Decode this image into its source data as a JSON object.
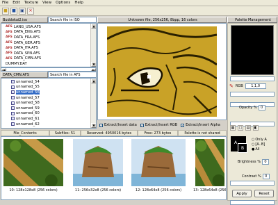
{
  "menu": [
    "File",
    "Edit",
    "Texture",
    "View",
    "Options",
    "Help"
  ],
  "left": {
    "tab_iso": "Buddokai2.iso",
    "search_iso": "Search file in ISO",
    "iso_files": [
      {
        "name": "LANG_USA.AFS",
        "tag": "AFS",
        "selected": false
      },
      {
        "name": "DATA_ENG.AFS",
        "tag": "AFS",
        "selected": false
      },
      {
        "name": "DATA_FRA.AFS",
        "tag": "AFS",
        "selected": false
      },
      {
        "name": "DATA_GER.AFS",
        "tag": "AFS",
        "selected": false
      },
      {
        "name": "DATA_ITA.AFS",
        "tag": "AFS",
        "selected": false
      },
      {
        "name": "DATA_SPN.AFS",
        "tag": "AFS",
        "selected": false
      },
      {
        "name": "DATA_CMN.AFS",
        "tag": "AFS",
        "selected": false
      },
      {
        "name": "DUMMY.DAT",
        "tag": "",
        "selected": false
      }
    ],
    "tab_afs": "DATA_CMN.AFS",
    "search_afs": "Search file in AFS",
    "afs_files": [
      {
        "name": "unnamed_54",
        "selected": false
      },
      {
        "name": "unnamed_55",
        "selected": false
      },
      {
        "name": "unnamed_56",
        "selected": true
      },
      {
        "name": "unnamed_57",
        "selected": false
      },
      {
        "name": "unnamed_58",
        "selected": false
      },
      {
        "name": "unnamed_59",
        "selected": false
      },
      {
        "name": "unnamed_60",
        "selected": false
      },
      {
        "name": "unnamed_61",
        "selected": false
      },
      {
        "name": "unnamed_62",
        "selected": false
      }
    ]
  },
  "viewer": {
    "title": "Unknown file, 256x256, 8bpp, 16 colors",
    "extract_data": "Extract/Insert data",
    "extract_rgb": "Extract/Insert RGB",
    "extract_alpha": "Extract/Insert Alpha"
  },
  "status": {
    "file_contents": "File_Contents",
    "subfiles": "Subfiles: 51",
    "reserved": "Reserved: 4950016 bytes",
    "free": "Free: 273 bytes",
    "palette": "Palette is not shared"
  },
  "thumbs": [
    {
      "caption": "10: 128x128x8 (256 colors)",
      "kind": "tree"
    },
    {
      "caption": "11: 256x32x8 (256 colors)",
      "kind": "island"
    },
    {
      "caption": "12: 128x64x8 (256 colors)",
      "kind": "island"
    },
    {
      "caption": "13: 128x64x8 (256 colors)",
      "kind": "tree"
    }
  ],
  "palette_panel": {
    "title": "Palette Management",
    "rgb_label": "RGB",
    "rgb_value": "1,1,0",
    "opacity_label": "Opacity %",
    "opacity_value": "0",
    "only_a": "Only A",
    "range_a": "[A..B]",
    "all": "All",
    "brightness_label": "Brightness %",
    "brightness_value": "0",
    "contrast_label": "Contrast %",
    "contrast_value": "0",
    "apply": "Apply",
    "reset": "Reset",
    "a": "A",
    "b": "B"
  },
  "colors": {
    "accent": "#316ac5",
    "texture_bg": "#c9a227"
  }
}
